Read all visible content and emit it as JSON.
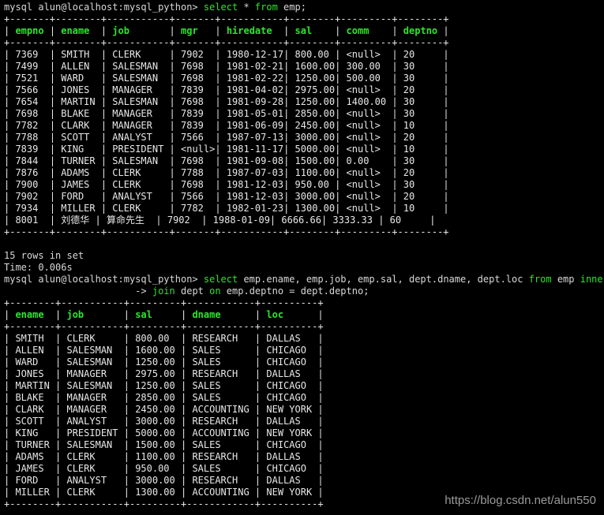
{
  "session": {
    "prompt": "mysql alun@localhost:mysql_python>",
    "cont_prompt": "->"
  },
  "query1": {
    "tokens": [
      {
        "t": "select",
        "kw": true
      },
      {
        "t": " * ",
        "kw": false
      },
      {
        "t": "from",
        "kw": true
      },
      {
        "t": " emp;",
        "kw": false
      }
    ],
    "columns": [
      {
        "name": "empno",
        "w": 7
      },
      {
        "name": "ename",
        "w": 8
      },
      {
        "name": "job",
        "w": 11
      },
      {
        "name": "mgr",
        "w": 7
      },
      {
        "name": "hiredate",
        "w": 11
      },
      {
        "name": "sal",
        "w": 8
      },
      {
        "name": "comm",
        "w": 9
      },
      {
        "name": "deptno",
        "w": 8
      }
    ],
    "rows": [
      [
        "7369",
        "SMITH",
        "CLERK",
        "7902",
        "1980-12-17",
        "800.00",
        "<null>",
        "20"
      ],
      [
        "7499",
        "ALLEN",
        "SALESMAN",
        "7698",
        "1981-02-21",
        "1600.00",
        "300.00",
        "30"
      ],
      [
        "7521",
        "WARD",
        "SALESMAN",
        "7698",
        "1981-02-22",
        "1250.00",
        "500.00",
        "30"
      ],
      [
        "7566",
        "JONES",
        "MANAGER",
        "7839",
        "1981-04-02",
        "2975.00",
        "<null>",
        "20"
      ],
      [
        "7654",
        "MARTIN",
        "SALESMAN",
        "7698",
        "1981-09-28",
        "1250.00",
        "1400.00",
        "30"
      ],
      [
        "7698",
        "BLAKE",
        "MANAGER",
        "7839",
        "1981-05-01",
        "2850.00",
        "<null>",
        "30"
      ],
      [
        "7782",
        "CLARK",
        "MANAGER",
        "7839",
        "1981-06-09",
        "2450.00",
        "<null>",
        "10"
      ],
      [
        "7788",
        "SCOTT",
        "ANALYST",
        "7566",
        "1987-07-13",
        "3000.00",
        "<null>",
        "20"
      ],
      [
        "7839",
        "KING",
        "PRESIDENT",
        "<null>",
        "1981-11-17",
        "5000.00",
        "<null>",
        "10"
      ],
      [
        "7844",
        "TURNER",
        "SALESMAN",
        "7698",
        "1981-09-08",
        "1500.00",
        "0.00",
        "30"
      ],
      [
        "7876",
        "ADAMS",
        "CLERK",
        "7788",
        "1987-07-03",
        "1100.00",
        "<null>",
        "20"
      ],
      [
        "7900",
        "JAMES",
        "CLERK",
        "7698",
        "1981-12-03",
        "950.00",
        "<null>",
        "30"
      ],
      [
        "7902",
        "FORD",
        "ANALYST",
        "7566",
        "1981-12-03",
        "3000.00",
        "<null>",
        "20"
      ],
      [
        "7934",
        "MILLER",
        "CLERK",
        "7782",
        "1982-01-23",
        "1300.00",
        "<null>",
        "10"
      ],
      [
        "8001",
        "刘德华",
        "算命先生",
        "7902",
        "1988-01-09",
        "6666.66",
        "3333.33",
        "60"
      ]
    ],
    "row_count": "15 rows in set",
    "time": "Time: 0.006s"
  },
  "query2": {
    "line1_tokens": [
      {
        "t": "select",
        "kw": true
      },
      {
        "t": " emp.ename, emp.job, emp.sal, dept.dname, dept.loc ",
        "kw": false
      },
      {
        "t": "from",
        "kw": true
      },
      {
        "t": " emp ",
        "kw": false
      },
      {
        "t": "inner",
        "kw": true
      }
    ],
    "line2_tokens": [
      {
        "t": "join",
        "kw": true
      },
      {
        "t": " dept ",
        "kw": false
      },
      {
        "t": "on",
        "kw": true
      },
      {
        "t": " emp.deptno = dept.deptno;",
        "kw": false
      }
    ],
    "columns": [
      {
        "name": "ename",
        "w": 8
      },
      {
        "name": "job",
        "w": 11
      },
      {
        "name": "sal",
        "w": 9
      },
      {
        "name": "dname",
        "w": 12
      },
      {
        "name": "loc",
        "w": 10
      }
    ],
    "rows": [
      [
        "SMITH",
        "CLERK",
        "800.00",
        "RESEARCH",
        "DALLAS"
      ],
      [
        "ALLEN",
        "SALESMAN",
        "1600.00",
        "SALES",
        "CHICAGO"
      ],
      [
        "WARD",
        "SALESMAN",
        "1250.00",
        "SALES",
        "CHICAGO"
      ],
      [
        "JONES",
        "MANAGER",
        "2975.00",
        "RESEARCH",
        "DALLAS"
      ],
      [
        "MARTIN",
        "SALESMAN",
        "1250.00",
        "SALES",
        "CHICAGO"
      ],
      [
        "BLAKE",
        "MANAGER",
        "2850.00",
        "SALES",
        "CHICAGO"
      ],
      [
        "CLARK",
        "MANAGER",
        "2450.00",
        "ACCOUNTING",
        "NEW YORK"
      ],
      [
        "SCOTT",
        "ANALYST",
        "3000.00",
        "RESEARCH",
        "DALLAS"
      ],
      [
        "KING",
        "PRESIDENT",
        "5000.00",
        "ACCOUNTING",
        "NEW YORK"
      ],
      [
        "TURNER",
        "SALESMAN",
        "1500.00",
        "SALES",
        "CHICAGO"
      ],
      [
        "ADAMS",
        "CLERK",
        "1100.00",
        "RESEARCH",
        "DALLAS"
      ],
      [
        "JAMES",
        "CLERK",
        "950.00",
        "SALES",
        "CHICAGO"
      ],
      [
        "FORD",
        "ANALYST",
        "3000.00",
        "RESEARCH",
        "DALLAS"
      ],
      [
        "MILLER",
        "CLERK",
        "1300.00",
        "ACCOUNTING",
        "NEW YORK"
      ]
    ]
  },
  "watermark": "https://blog.csdn.net/alun550"
}
